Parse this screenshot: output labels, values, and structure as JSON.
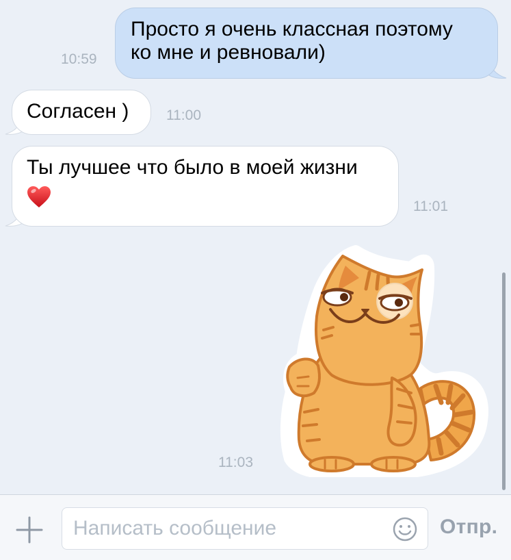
{
  "messages": [
    {
      "direction": "outgoing",
      "lines": [
        "Просто я очень классная поэтому",
        "ко мне и ревновали)"
      ],
      "time": "10:59"
    },
    {
      "direction": "incoming",
      "lines": [
        "Согласен )"
      ],
      "time": "11:00"
    },
    {
      "direction": "incoming",
      "lines": [
        "Ты лучшее что было в моей жизни"
      ],
      "emoji": "heart-icon",
      "time": "11:01"
    },
    {
      "direction": "outgoing",
      "type": "sticker",
      "sticker": "orange-cat-sticker",
      "time": "11:03"
    }
  ],
  "composer": {
    "attach_icon": "plus-icon",
    "placeholder": "Написать сообщение",
    "value": "",
    "emoji_icon": "smiley-icon",
    "send_label": "Отпр."
  },
  "colors": {
    "background": "#ebf0f7",
    "outgoing_bubble": "#cce0f8",
    "incoming_bubble": "#ffffff",
    "timestamp": "#aab4bf",
    "send_label": "#98a2ae",
    "cat_orange": "#f0a64a"
  }
}
